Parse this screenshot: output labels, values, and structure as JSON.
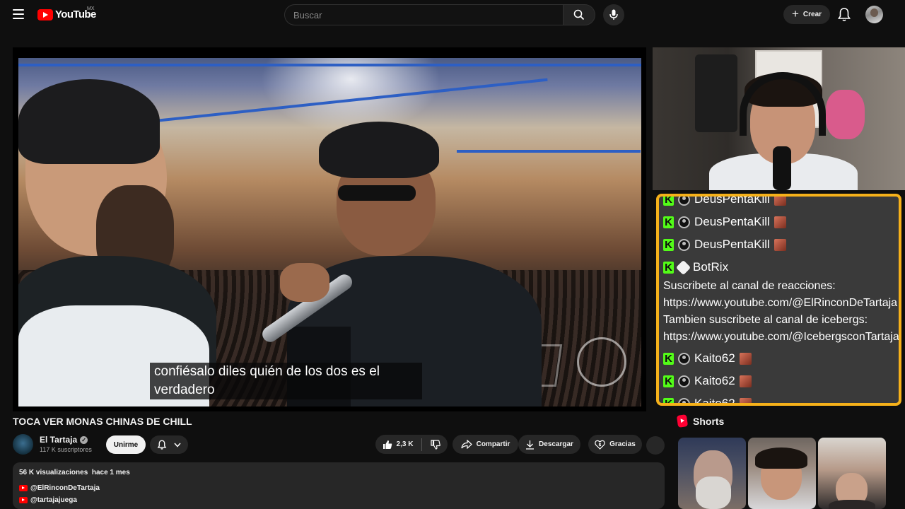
{
  "topbar": {
    "logo_text": "YouTube",
    "country_code": "MX",
    "search_placeholder": "Buscar",
    "create_label": "Crear"
  },
  "video": {
    "subtitle": "confiésalo diles quién de los dos es el verdadero",
    "title": "TOCA VER MONAS CHINAS DE CHILL"
  },
  "channel": {
    "name": "El Tartaja",
    "subscribers": "117 K suscriptores",
    "join_label": "Unirme"
  },
  "actions": {
    "likes": "2,3 K",
    "share_label": "Compartir",
    "download_label": "Descargar",
    "thanks_label": "Gracias"
  },
  "description": {
    "views": "56 K visualizaciones",
    "date": "hace 1 mes",
    "links": [
      "@ElRinconDeTartaja",
      "@tartajajuega"
    ]
  },
  "chat": {
    "messages": [
      {
        "user": "DeusPentaKill",
        "type": "user"
      },
      {
        "user": "DeusPentaKill",
        "type": "user"
      },
      {
        "user": "DeusPentaKill",
        "type": "user"
      },
      {
        "user": "BotRix",
        "type": "bot"
      },
      {
        "user": "Kaito62",
        "type": "user"
      },
      {
        "user": "Kaito62",
        "type": "user"
      },
      {
        "user": "Kaito62",
        "type": "user"
      }
    ],
    "bot_message_lines": [
      "Suscribete al canal de reacciones:",
      "https://www.youtube.com/@ElRinconDeTartaja",
      "Tambien suscribete al canal de icebergs:",
      "https://www.youtube.com/@IcebergsconTartaja"
    ]
  },
  "shorts": {
    "header": "Shorts"
  },
  "colors": {
    "accent_red": "#ff0000",
    "chat_border": "#f6b11a",
    "kick_green": "#53fc18"
  }
}
